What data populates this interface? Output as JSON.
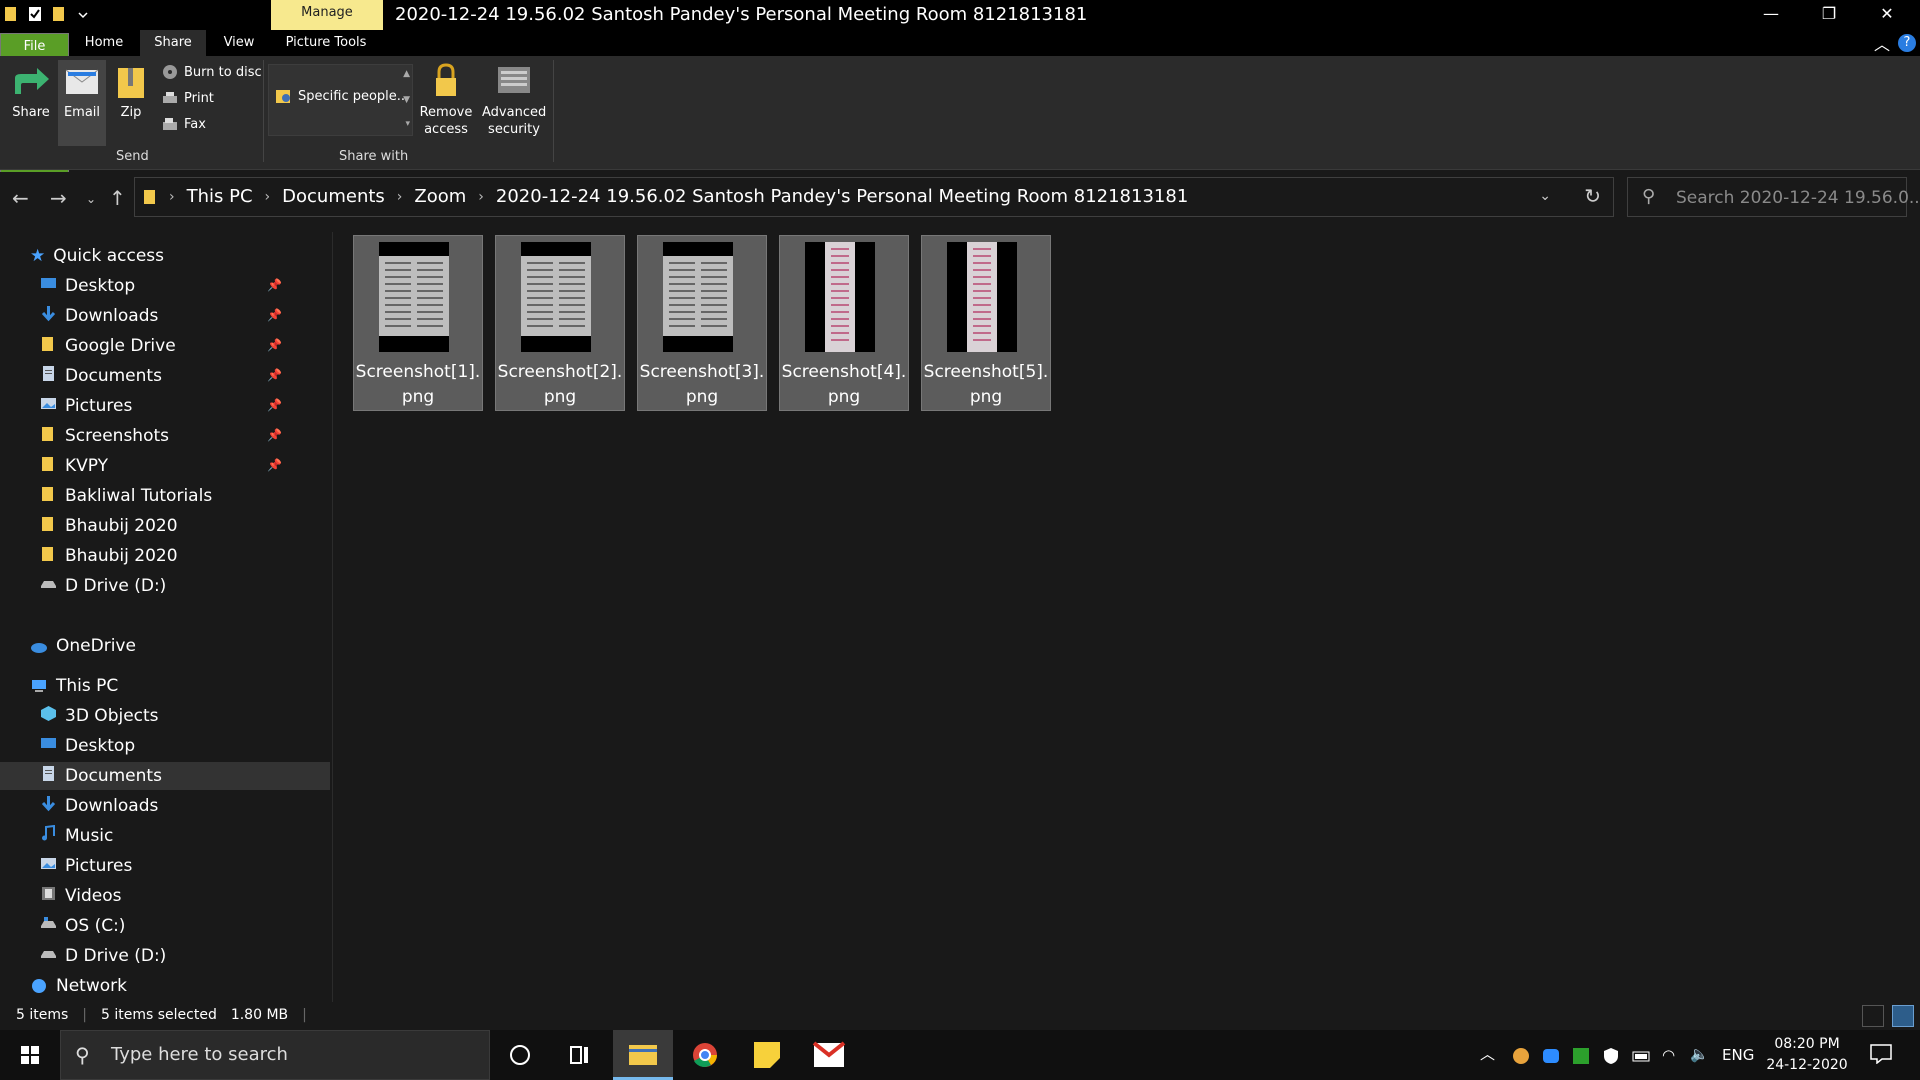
{
  "window": {
    "title": "2020-12-24 19.56.02 Santosh Pandey's Personal Meeting Room 8121813181",
    "manage_tab": "Manage",
    "minimize": "—",
    "maximize": "❐",
    "close": "✕"
  },
  "ribbon_tabs": [
    {
      "label": "File"
    },
    {
      "label": "Home"
    },
    {
      "label": "Share"
    },
    {
      "label": "View"
    },
    {
      "label": "Picture Tools"
    }
  ],
  "help": "?",
  "ribbon": {
    "share": "Share",
    "email": "Email",
    "zip": "Zip",
    "burn": "Burn to disc",
    "print": "Print",
    "fax": "Fax",
    "group_send": "Send",
    "specific_people": "Specific people...",
    "remove_access_1": "Remove",
    "remove_access_2": "access",
    "advanced_security_1": "Advanced",
    "advanced_security_2": "security",
    "group_share_with": "Share with"
  },
  "address": {
    "crumbs": [
      "This PC",
      "Documents",
      "Zoom",
      "2020-12-24 19.56.02 Santosh Pandey's Personal Meeting Room 8121813181"
    ],
    "search_placeholder": "Search 2020-12-24 19.56.0..."
  },
  "sidebar": {
    "quick_access": "Quick access",
    "quick_items": [
      {
        "label": "Desktop",
        "icon": "desktop-icon"
      },
      {
        "label": "Downloads",
        "icon": "downloads-icon"
      },
      {
        "label": "Google Drive",
        "icon": "folder-icon"
      },
      {
        "label": "Documents",
        "icon": "documents-icon"
      },
      {
        "label": "Pictures",
        "icon": "pictures-icon"
      },
      {
        "label": "Screenshots",
        "icon": "folder-icon"
      },
      {
        "label": "KVPY",
        "icon": "folder-icon"
      },
      {
        "label": "Bakliwal Tutorials",
        "icon": "folder-icon"
      },
      {
        "label": "Bhaubij 2020",
        "icon": "folder-icon"
      },
      {
        "label": "Bhaubij 2020",
        "icon": "folder-icon"
      },
      {
        "label": "D Drive (D:)",
        "icon": "drive-icon"
      }
    ],
    "onedrive": "OneDrive",
    "this_pc": "This PC",
    "pc_items": [
      {
        "label": "3D Objects"
      },
      {
        "label": "Desktop"
      },
      {
        "label": "Documents"
      },
      {
        "label": "Downloads"
      },
      {
        "label": "Music"
      },
      {
        "label": "Pictures"
      },
      {
        "label": "Videos"
      },
      {
        "label": "OS (C:)"
      },
      {
        "label": "D Drive (D:)"
      }
    ],
    "network": "Network"
  },
  "files": [
    {
      "name_line1": "Screenshot[1].",
      "name_line2": "png"
    },
    {
      "name_line1": "Screenshot[2].",
      "name_line2": "png"
    },
    {
      "name_line1": "Screenshot[3].",
      "name_line2": "png"
    },
    {
      "name_line1": "Screenshot[4].",
      "name_line2": "png"
    },
    {
      "name_line1": "Screenshot[5].",
      "name_line2": "png"
    }
  ],
  "status": {
    "items": "5 items",
    "selected": "5 items selected",
    "size": "1.80 MB"
  },
  "taskbar": {
    "search_placeholder": "Type here to search",
    "lang": "ENG",
    "time": "08:20 PM",
    "date": "24-12-2020"
  },
  "colors": {
    "file_tab": "#5a9e26",
    "manage_tab": "#f7e98e",
    "selection": "#5c5c5c",
    "folder": "#f2c84b",
    "accent_blue": "#2a7de1"
  }
}
